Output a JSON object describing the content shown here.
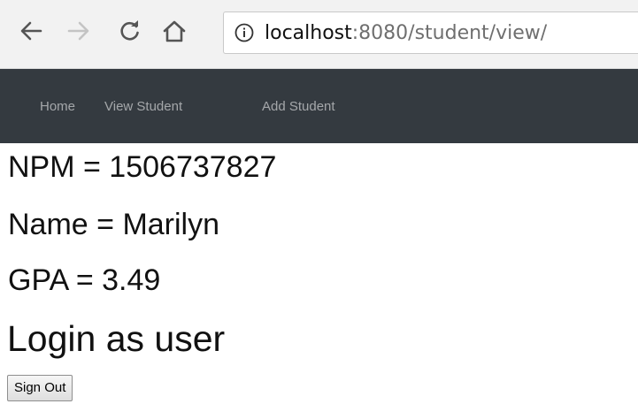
{
  "browser": {
    "url_host": "localhost",
    "url_path": ":8080/student/view/",
    "icons": {
      "back": "back-arrow-icon",
      "forward": "forward-arrow-icon",
      "reload": "reload-icon",
      "home": "home-icon",
      "info": "info-icon"
    }
  },
  "navbar": {
    "links": [
      {
        "label": "Home"
      },
      {
        "label": "View Student"
      },
      {
        "label": "Add Student"
      }
    ],
    "background_color": "#343a40"
  },
  "student": {
    "npm_line": "NPM = 1506737827",
    "name_line": "Name = Marilyn",
    "gpa_line": "GPA = 3.49"
  },
  "login_heading": "Login as user",
  "signout_label": "Sign Out"
}
